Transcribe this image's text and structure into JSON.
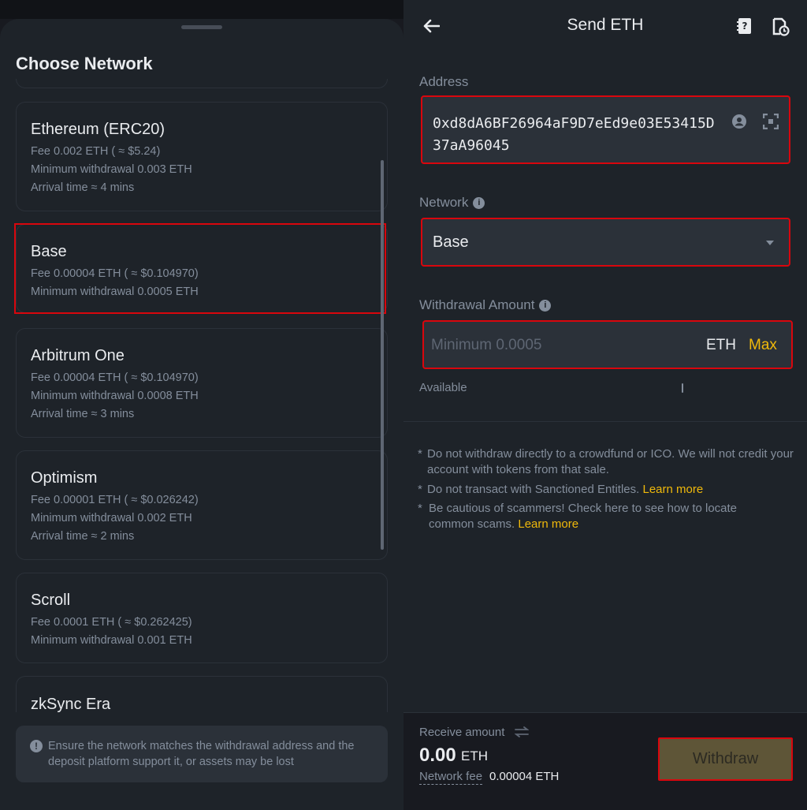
{
  "network_sheet": {
    "title": "Choose Network",
    "networks": [
      {
        "name": "Ethereum (ERC20)",
        "fee": "Fee 0.002 ETH ( ≈ $5.24)",
        "min": "Minimum withdrawal 0.003 ETH",
        "arrival": "Arrival time ≈ 4 mins"
      },
      {
        "name": "Base",
        "fee": "Fee 0.00004 ETH ( ≈ $0.104970)",
        "min": "Minimum withdrawal 0.0005 ETH",
        "selected": true
      },
      {
        "name": "Arbitrum One",
        "fee": "Fee 0.00004 ETH ( ≈ $0.104970)",
        "min": "Minimum withdrawal 0.0008 ETH",
        "arrival": "Arrival time ≈ 3 mins"
      },
      {
        "name": "Optimism",
        "fee": "Fee 0.00001 ETH ( ≈ $0.026242)",
        "min": "Minimum withdrawal 0.002 ETH",
        "arrival": "Arrival time ≈ 2 mins"
      },
      {
        "name": "Scroll",
        "fee": "Fee 0.0001 ETH ( ≈ $0.262425)",
        "min": "Minimum withdrawal 0.001 ETH"
      },
      {
        "name": "zkSync Era"
      }
    ],
    "notice": "Ensure the network matches the withdrawal address and the deposit platform support it,   or assets may be lost"
  },
  "send_form": {
    "title": "Send ETH",
    "address_label": "Address",
    "address_value": "0xd8dA6BF26964aF9D7eEd9e03E53415D37aA96045",
    "network_label": "Network",
    "network_value": "Base",
    "amount_label": "Withdrawal Amount",
    "amount_placeholder": "Minimum 0.0005",
    "amount_unit": "ETH",
    "max_label": "Max",
    "available_label": "Available",
    "warnings": [
      {
        "text": "Do not withdraw directly to a crowdfund or ICO. We will not credit your account with tokens from that sale.",
        "link": ""
      },
      {
        "text": "Do not transact with Sanctioned Entitles. ",
        "link": "Learn more"
      },
      {
        "text": "Be cautious of scammers! Check here to see how to locate common scams. ",
        "link": "Learn more"
      }
    ],
    "receive_label": "Receive amount",
    "receive_amount": "0.00",
    "receive_unit": "ETH",
    "fee_label": "Network fee",
    "fee_value": "0.00004 ETH",
    "withdraw_label": "Withdraw"
  },
  "colors": {
    "accent": "#f0b90b",
    "highlight": "#d9060d",
    "background": "#1e2329"
  },
  "icons": [
    "back-arrow-icon",
    "address-book-icon",
    "history-icon",
    "contact-icon",
    "scan-icon",
    "info-icon",
    "chevron-down-icon",
    "swap-icon",
    "alert-icon"
  ]
}
